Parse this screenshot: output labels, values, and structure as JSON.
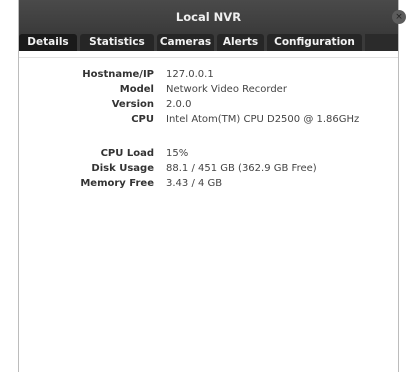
{
  "window": {
    "title": "Local NVR",
    "close_glyph": "×"
  },
  "tabs": [
    {
      "label": "Details",
      "active": true
    },
    {
      "label": "Statistics",
      "active": false
    },
    {
      "label": "Cameras",
      "active": false
    },
    {
      "label": "Alerts",
      "active": false
    },
    {
      "label": "Configuration",
      "active": false
    }
  ],
  "details": {
    "hostname_label": "Hostname/IP",
    "hostname_value": "127.0.0.1",
    "model_label": "Model",
    "model_value": "Network Video Recorder",
    "version_label": "Version",
    "version_value": "2.0.0",
    "cpu_label": "CPU",
    "cpu_value": "Intel Atom(TM) CPU D2500 @ 1.86GHz"
  },
  "stats": {
    "cpu_load_label": "CPU Load",
    "cpu_load_value": "15%",
    "disk_label": "Disk Usage",
    "disk_value": "88.1 / 451 GB (362.9 GB Free)",
    "memory_label": "Memory Free",
    "memory_value": "3.43 / 4 GB"
  }
}
